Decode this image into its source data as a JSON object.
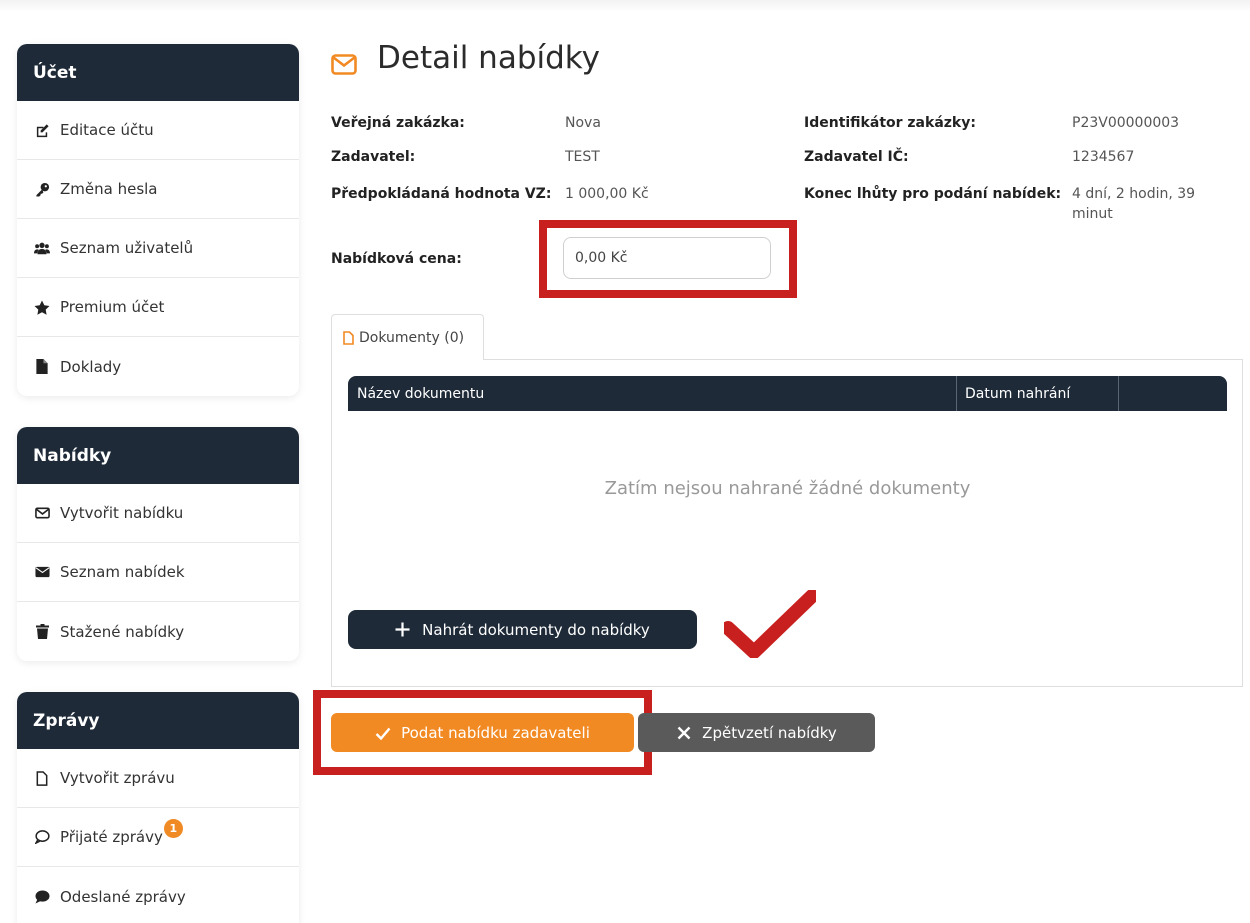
{
  "sidebar": {
    "account": {
      "title": "Účet",
      "items": [
        {
          "label": "Editace účtu",
          "icon": "edit-icon"
        },
        {
          "label": "Změna hesla",
          "icon": "key-icon"
        },
        {
          "label": "Seznam uživatelů",
          "icon": "users-icon"
        },
        {
          "label": "Premium účet",
          "icon": "star-icon"
        },
        {
          "label": "Doklady",
          "icon": "file-icon"
        }
      ]
    },
    "offers": {
      "title": "Nabídky",
      "items": [
        {
          "label": "Vytvořit nabídku",
          "icon": "envelope-outline-icon"
        },
        {
          "label": "Seznam nabídek",
          "icon": "envelope-icon"
        },
        {
          "label": "Stažené nabídky",
          "icon": "trash-icon"
        }
      ]
    },
    "messages": {
      "title": "Zprávy",
      "items": [
        {
          "label": "Vytvořit zprávu",
          "icon": "file-outline-icon"
        },
        {
          "label": "Přijaté zprávy",
          "icon": "comment-outline-icon",
          "badge": "1"
        },
        {
          "label": "Odeslané zprávy",
          "icon": "comment-icon"
        }
      ]
    }
  },
  "page": {
    "title": "Detail nabídky",
    "title_icon": "envelope-outline-icon"
  },
  "details": {
    "public_contract_label": "Veřejná zakázka:",
    "public_contract_value": "Nova",
    "contracting_authority_label": "Zadavatel:",
    "contracting_authority_value": "TEST",
    "expected_value_label": "Předpokládaná hodnota VZ:",
    "expected_value_value": "1 000,00 Kč",
    "contract_id_label": "Identifikátor zakázky:",
    "contract_id_value": "P23V00000003",
    "authority_ic_label": "Zadavatel IČ:",
    "authority_ic_value": "1234567",
    "deadline_label": "Konec lhůty pro podání nabídek:",
    "deadline_value_line1": "4 dní, 2 hodin, 39",
    "deadline_value_line2": "minut",
    "offer_price_label": "Nabídková cena:",
    "offer_price_value": "0,00 Kč"
  },
  "documents": {
    "tab_label": "Dokumenty (0)",
    "col_name": "Název dokumentu",
    "col_date": "Datum nahrání",
    "empty_message": "Zatím nejsou nahrané žádné dokumenty",
    "upload_label": "Nahrát dokumenty do nabídky"
  },
  "actions": {
    "submit_label": "Podat nabídku zadavateli",
    "withdraw_label": "Zpětvzetí nabídky"
  },
  "colors": {
    "nav_dark": "#1e2a38",
    "accent_orange": "#f28a24",
    "annotation_red": "#c8201e",
    "withdraw_gray": "#5a5a5a"
  }
}
